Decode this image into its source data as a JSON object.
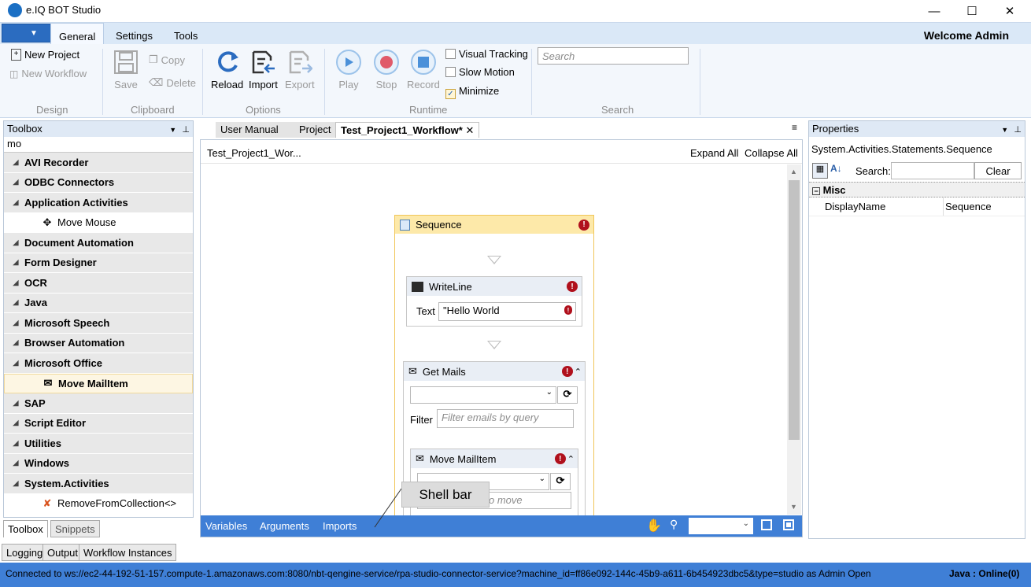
{
  "window": {
    "title": "e.IQ BOT Studio",
    "minimize_icon": "minimize-icon",
    "maximize_icon": "maximize-icon",
    "close_icon": "close-icon"
  },
  "ribbon_tabs": [
    "General",
    "Settings",
    "Tools"
  ],
  "welcome": "Welcome  Admin",
  "ribbon": {
    "design": {
      "label": "Design",
      "new_project": "New Project",
      "new_workflow": "New Workflow"
    },
    "clipboard": {
      "label": "Clipboard",
      "save": "Save",
      "copy": "Copy",
      "delete": "Delete"
    },
    "options": {
      "label": "Options",
      "reload": "Reload",
      "import": "Import",
      "export": "Export"
    },
    "runtime": {
      "label": "Runtime",
      "play": "Play",
      "stop": "Stop",
      "record": "Record",
      "visual_tracking": "Visual Tracking",
      "slow_motion": "Slow Motion",
      "minimize": "Minimize",
      "visual_tracking_checked": false,
      "slow_motion_checked": false,
      "minimize_checked": true
    },
    "search": {
      "label": "Search",
      "placeholder": "Search"
    }
  },
  "toolbox": {
    "title": "Toolbox",
    "filter": "mo",
    "rows": [
      {
        "type": "cat",
        "label": "AVI Recorder"
      },
      {
        "type": "cat",
        "label": "ODBC Connectors"
      },
      {
        "type": "cat",
        "label": "Application Activities"
      },
      {
        "type": "item",
        "label": "Move Mouse",
        "icon": "move-mouse-icon"
      },
      {
        "type": "cat",
        "label": "Document Automation"
      },
      {
        "type": "cat",
        "label": "Form Designer"
      },
      {
        "type": "cat",
        "label": "OCR"
      },
      {
        "type": "cat",
        "label": "Java"
      },
      {
        "type": "cat",
        "label": "Microsoft Speech"
      },
      {
        "type": "cat",
        "label": "Browser Automation"
      },
      {
        "type": "cat",
        "label": "Microsoft Office"
      },
      {
        "type": "item",
        "label": "Move MailItem",
        "icon": "mail-icon",
        "selected": true
      },
      {
        "type": "cat",
        "label": "SAP"
      },
      {
        "type": "cat",
        "label": "Script Editor"
      },
      {
        "type": "cat",
        "label": "Utilities"
      },
      {
        "type": "cat",
        "label": "Windows"
      },
      {
        "type": "cat",
        "label": "System.Activities"
      },
      {
        "type": "item",
        "label": "RemoveFromCollection<>",
        "icon": "remove-collection-icon"
      }
    ],
    "tabs": [
      "Toolbox",
      "Snippets"
    ]
  },
  "bottom_tabs": [
    "Logging",
    "Output",
    "Workflow Instances"
  ],
  "doc_tabs": [
    "User Manual",
    "Project",
    "Test_Project1_Workflow*"
  ],
  "designer": {
    "breadcrumb": "Test_Project1_Wor...",
    "expand_all": "Expand All",
    "collapse_all": "Collapse All",
    "sequence": "Sequence",
    "writeline": {
      "title": "WriteLine",
      "text_label": "Text",
      "text_value": "\"Hello World"
    },
    "getmails": {
      "title": "Get Mails",
      "filter_label": "Filter",
      "filter_placeholder": "Filter emails by query"
    },
    "movemail": {
      "title": "Move MailItem",
      "partial_text": "o move"
    },
    "footer": {
      "variables": "Variables",
      "arguments": "Arguments",
      "imports": "Imports"
    }
  },
  "callout": "Shell bar",
  "properties": {
    "title": "Properties",
    "type_name": "System.Activities.Statements.Sequence",
    "search_label": "Search:",
    "clear": "Clear",
    "category": "Misc",
    "rows": [
      {
        "name": "DisplayName",
        "value": "Sequence"
      }
    ]
  },
  "status": {
    "connection": "Connected to ws://ec2-44-192-51-157.compute-1.amazonaws.com:8080/nbt-qengine-service/rpa-studio-connector-service?machine_id=ff86e092-144c-45b9-a611-6b454923dbc5&type=studio as Admin  Open",
    "java": "Java : Online(0)"
  }
}
